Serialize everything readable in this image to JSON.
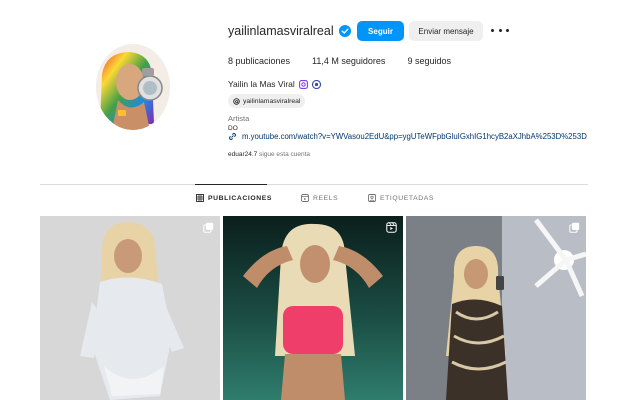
{
  "profile": {
    "username": "yailinlamasviralreal",
    "follow_label": "Seguir",
    "message_label": "Enviar mensaje",
    "stats": {
      "posts": "8 publicaciones",
      "followers": "11,4 M seguidores",
      "following": "9 seguidos"
    },
    "full_name": "Yailin la Mas Viral",
    "threads_handle": "yailinlamasviralreal",
    "category": "Artista",
    "bio_line": "DO",
    "link": "m.youtube.com/watch?v=YWVasou2EdU&pp=ygUTeWFpbGluIGxhIG1hcyB2aXJhbA%253D%253D",
    "followed_by_user": "eduar24.7",
    "followed_by_text": " sigue esta cuenta"
  },
  "tabs": [
    {
      "label": "PUBLICACIONES",
      "icon": "grid-icon",
      "active": true
    },
    {
      "label": "REELS",
      "icon": "reels-icon",
      "active": false
    },
    {
      "label": "ETIQUETADAS",
      "icon": "tagged-icon",
      "active": false
    }
  ],
  "posts": [
    {
      "badge": "carousel-icon"
    },
    {
      "badge": "reel-icon"
    },
    {
      "badge": "carousel-icon"
    }
  ],
  "colors": {
    "accent": "#0095f6",
    "link": "#00376b",
    "muted": "#737373"
  }
}
